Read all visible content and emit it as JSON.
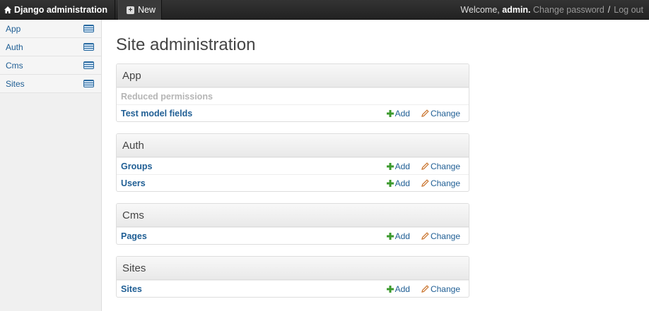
{
  "topbar": {
    "brand": "Django administration",
    "new_label": "New",
    "welcome": "Welcome, ",
    "username": "admin.",
    "change_password": "Change password",
    "separator": "/",
    "logout": "Log out"
  },
  "sidebar": {
    "items": [
      {
        "label": "App"
      },
      {
        "label": "Auth"
      },
      {
        "label": "Cms"
      },
      {
        "label": "Sites"
      }
    ]
  },
  "main": {
    "title": "Site administration",
    "add_label": "Add",
    "change_label": "Change",
    "modules": [
      {
        "title": "App",
        "rows": [
          {
            "name": "Reduced permissions"
          },
          {
            "name": "Test model fields"
          }
        ]
      },
      {
        "title": "Auth",
        "rows": [
          {
            "name": "Groups"
          },
          {
            "name": "Users"
          }
        ]
      },
      {
        "title": "Cms",
        "rows": [
          {
            "name": "Pages"
          }
        ]
      },
      {
        "title": "Sites",
        "rows": [
          {
            "name": "Sites"
          }
        ]
      }
    ]
  },
  "colors": {
    "link": "#1f5e94",
    "topbar": "#222222",
    "add_icon": "#3c9a2e",
    "change_icon": "#c9722a"
  }
}
